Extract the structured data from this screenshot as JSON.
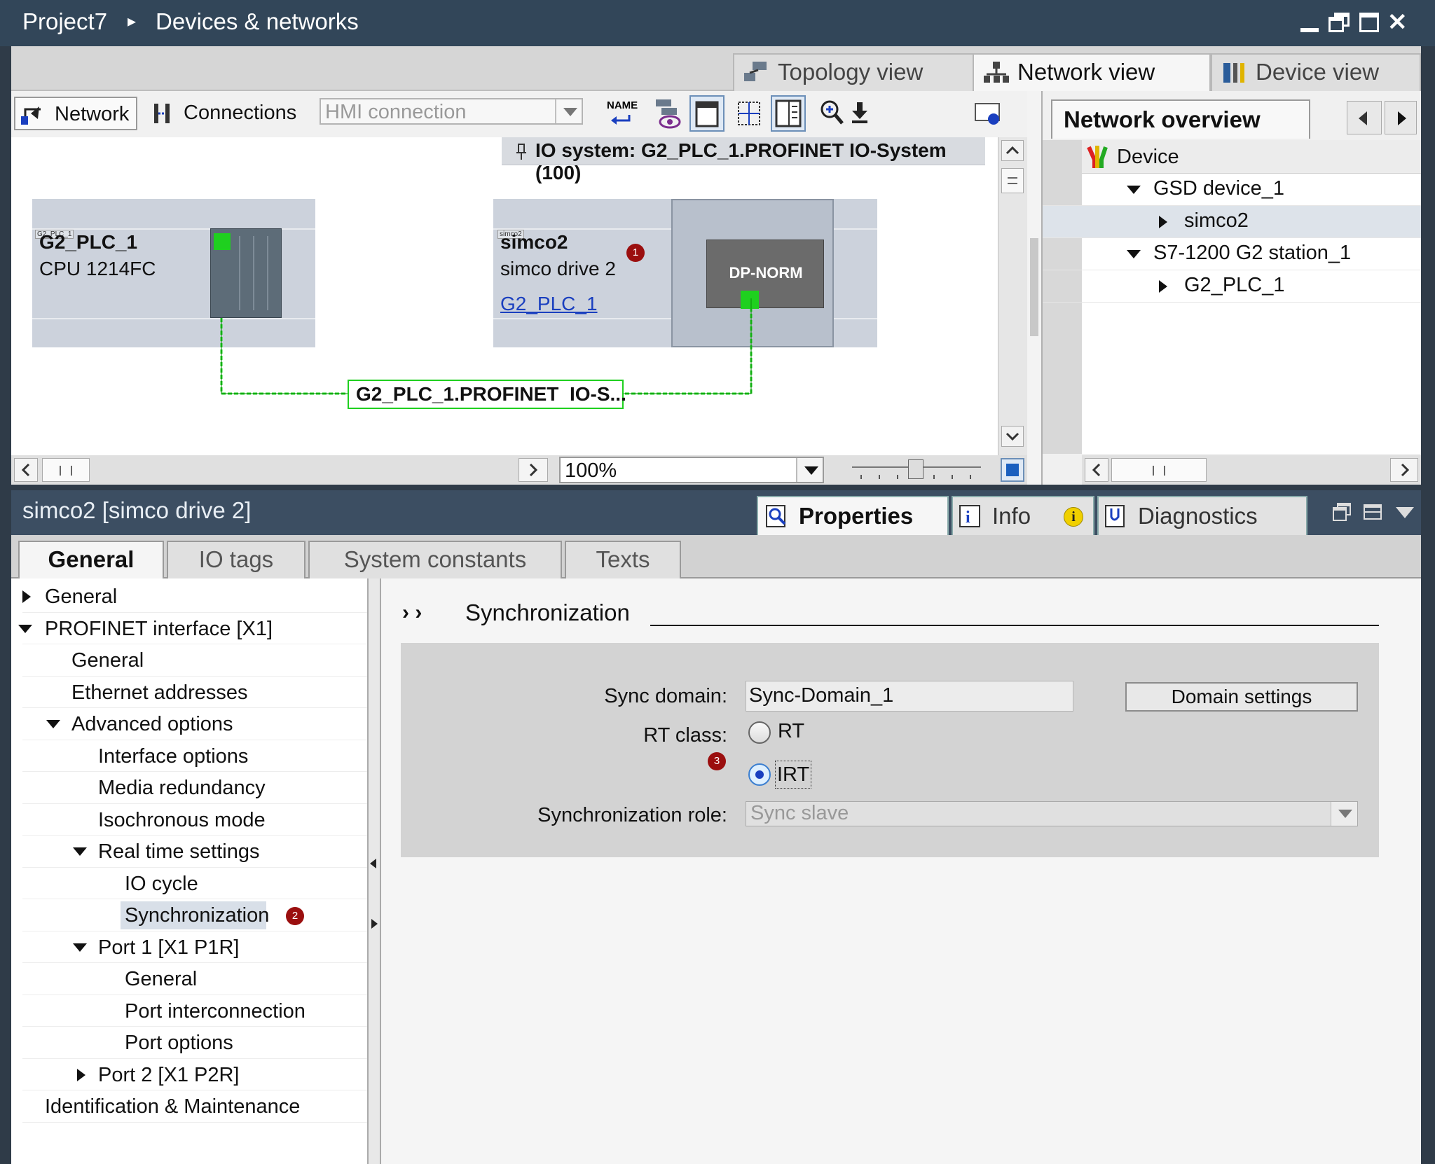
{
  "title": {
    "project": "Project7",
    "separator": "▸",
    "section": "Devices & networks"
  },
  "view_tabs": [
    {
      "label": "Topology view",
      "icon": "topology-icon",
      "active": false
    },
    {
      "label": "Network view",
      "icon": "network-icon",
      "active": true
    },
    {
      "label": "Device view",
      "icon": "device-view-icon",
      "active": false
    }
  ],
  "toolbar": {
    "network_label": "Network",
    "connections_label": "Connections",
    "connection_type": "HMI connection",
    "name_icon_text": "NAME"
  },
  "io_system_label": "IO system: G2_PLC_1.PROFINET IO-System (100)",
  "devices": {
    "plc": {
      "tag": "G2_PLC_1",
      "name": "G2_PLC_1",
      "type": "CPU 1214FC"
    },
    "drive": {
      "tag": "simco2",
      "name": "simco2",
      "type": "simco drive 2",
      "link": "G2_PLC_1",
      "module": "DP-NORM",
      "badge": "1"
    }
  },
  "network_line_label": "G2_PLC_1.PROFINET  IO-S...",
  "zoom": "100%",
  "overview": {
    "title": "Network overview",
    "column": "Device",
    "rows": [
      {
        "label": "GSD device_1",
        "expanded": true,
        "level": 1
      },
      {
        "label": "simco2",
        "expanded": false,
        "level": 2
      },
      {
        "label": "S7-1200 G2 station_1",
        "expanded": true,
        "level": 1
      },
      {
        "label": "G2_PLC_1",
        "expanded": false,
        "level": 2
      }
    ]
  },
  "properties": {
    "object": "simco2 [simco drive 2]",
    "tabs": [
      {
        "label": "Properties",
        "active": true
      },
      {
        "label": "Info",
        "active": false
      },
      {
        "label": "Diagnostics",
        "active": false
      }
    ],
    "subtabs": [
      {
        "label": "General",
        "active": true
      },
      {
        "label": "IO tags",
        "active": false
      },
      {
        "label": "System constants",
        "active": false
      },
      {
        "label": "Texts",
        "active": false
      }
    ],
    "tree": [
      {
        "label": "General",
        "level": 0,
        "arrow": "right"
      },
      {
        "label": "PROFINET interface [X1]",
        "level": 0,
        "arrow": "down"
      },
      {
        "label": "General",
        "level": 1,
        "arrow": "none"
      },
      {
        "label": "Ethernet addresses",
        "level": 1,
        "arrow": "none"
      },
      {
        "label": "Advanced options",
        "level": 1,
        "arrow": "down"
      },
      {
        "label": "Interface options",
        "level": 2,
        "arrow": "none"
      },
      {
        "label": "Media redundancy",
        "level": 2,
        "arrow": "none"
      },
      {
        "label": "Isochronous mode",
        "level": 2,
        "arrow": "none"
      },
      {
        "label": "Real time settings",
        "level": 2,
        "arrow": "down"
      },
      {
        "label": "IO cycle",
        "level": 3,
        "arrow": "none"
      },
      {
        "label": "Synchronization",
        "level": 3,
        "arrow": "none",
        "selected": true,
        "badge": "2"
      },
      {
        "label": "Port 1 [X1 P1R]",
        "level": 2,
        "arrow": "down"
      },
      {
        "label": "General",
        "level": 3,
        "arrow": "none"
      },
      {
        "label": "Port interconnection",
        "level": 3,
        "arrow": "none"
      },
      {
        "label": "Port options",
        "level": 3,
        "arrow": "none"
      },
      {
        "label": "Port 2 [X1 P2R]",
        "level": 2,
        "arrow": "right"
      },
      {
        "label": "Identification & Maintenance",
        "level": 0,
        "arrow": "none"
      }
    ],
    "breadcrumb_arrows": "› ›",
    "section_title": "Synchronization",
    "sync_domain_label": "Sync domain:",
    "sync_domain_value": "Sync-Domain_1",
    "domain_settings_button": "Domain settings",
    "rt_class_label": "RT class:",
    "rt_options": [
      {
        "label": "RT",
        "checked": false
      },
      {
        "label": "IRT",
        "checked": true
      }
    ],
    "rt_badge": "3",
    "sync_role_label": "Synchronization role:",
    "sync_role_value": "Sync slave"
  },
  "colors": {
    "titlebar": "#324659",
    "accent_green": "#1fd01f",
    "badge_red": "#9b0f0f",
    "link_blue": "#1a3fbf"
  }
}
